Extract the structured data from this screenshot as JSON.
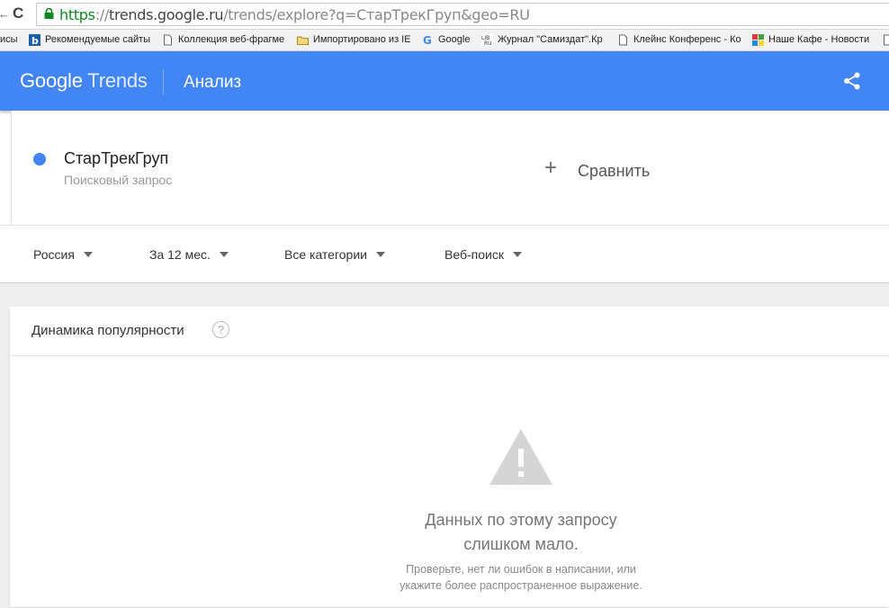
{
  "browser": {
    "back_fragment": "←",
    "reload": "C",
    "url_scheme": "https",
    "url_sep": "://",
    "url_host": "trends.google.ru",
    "url_path": "/trends/explore?q=СтарТрекГруп&geo=RU"
  },
  "bookmarks": [
    {
      "label": "исы",
      "icon": "none"
    },
    {
      "label": "Рекомендуемые сайты",
      "icon": "bing-icon"
    },
    {
      "label": "Коллекция веб-фрагме",
      "icon": "page-icon"
    },
    {
      "label": "Импортировано из IE",
      "icon": "folder-icon"
    },
    {
      "label": "Google",
      "icon": "google-icon"
    },
    {
      "label": "Журнал \"Самиздат\".Кр",
      "icon": "libru-icon"
    },
    {
      "label": "Клейнс Конференс - Ко",
      "icon": "page-icon"
    },
    {
      "label": "Наше Кафе - Новости",
      "icon": "kafe-icon"
    }
  ],
  "header": {
    "logo_google": "Google",
    "logo_trends": "Trends",
    "title": "Анализ",
    "share_icon": "share-icon",
    "color": "#4285f4"
  },
  "term": {
    "name": "СтарТрекГруп",
    "type": "Поисковый запрос",
    "color": "#4285f4"
  },
  "compare": {
    "plus": "+",
    "label": "Сравнить"
  },
  "filters": {
    "region": "Россия",
    "period": "За 12 мес.",
    "category": "Все категории",
    "search_type": "Веб-поиск"
  },
  "panel": {
    "title": "Динамика популярности",
    "help": "?",
    "message_line1": "Данных по этому запросу",
    "message_line2": "слишком мало.",
    "hint_line1": "Проверьте, нет ли ошибок в написании, или",
    "hint_line2": "укажите более распространенное выражение."
  }
}
